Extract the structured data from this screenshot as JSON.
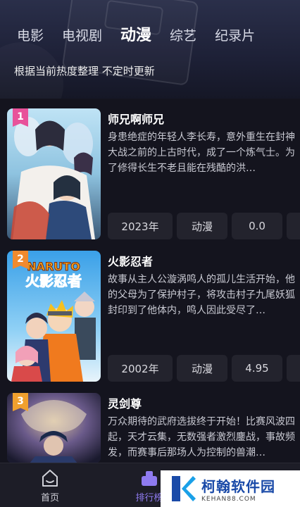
{
  "tabs": [
    {
      "label": "电影",
      "active": false
    },
    {
      "label": "电视剧",
      "active": false
    },
    {
      "label": "动漫",
      "active": true
    },
    {
      "label": "综艺",
      "active": false
    },
    {
      "label": "纪录片",
      "active": false
    }
  ],
  "subtitle": "根据当前热度整理 不定时更新",
  "items": [
    {
      "rank": "1",
      "rank_color": "#e8529a",
      "title": "师兄啊师兄",
      "desc": "身患绝症的年轻人李长寿，意外重生在封神大战之前的上古时代，成了一个炼气士。为了修得长生不老且能在残酷的洪…",
      "year": "2023年",
      "type": "动漫",
      "score": "0.0"
    },
    {
      "rank": "2",
      "rank_color": "#f08a2e",
      "title": "火影忍者",
      "desc": "故事从主人公漩涡鸣人的孤儿生活开始，他的父母为了保护村子，将攻击村子九尾妖狐封印到了他体内，鸣人因此受尽了…",
      "year": "2002年",
      "type": "动漫",
      "score": "4.95",
      "poster_text": "NARUTO 火影忍者"
    },
    {
      "rank": "3",
      "rank_color": "#f0a02e",
      "title": "灵剑尊",
      "desc": "万众期待的武府选拔终于开始！比赛风波四起，天才云集，无数强者激烈鏖战，事故频发，而赛事后那场人为控制的兽潮…"
    }
  ],
  "bottom_nav": [
    {
      "label": "首页",
      "icon": "home-icon",
      "active": false
    },
    {
      "label": "排行榜",
      "icon": "ranking-icon",
      "active": true
    }
  ],
  "watermark": {
    "cn": "柯翰软件园",
    "en": "KEHAN88.COM"
  }
}
